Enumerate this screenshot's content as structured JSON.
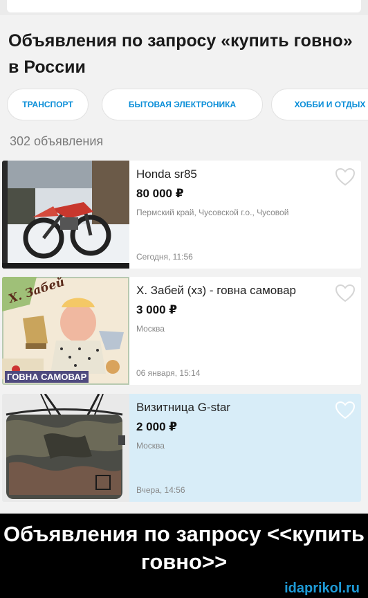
{
  "header": {
    "title": "Объявления по запросу «купить говно» в России"
  },
  "categories": [
    {
      "label": "ТРАНСПОРТ"
    },
    {
      "label": "БЫТОВАЯ ЭЛЕКТРОНИКА"
    },
    {
      "label": "ХОББИ И ОТДЫХ"
    }
  ],
  "results_count": "302 объявления",
  "listings": [
    {
      "title": "Honda sr85",
      "price": "80 000 ₽",
      "location": "Пермский край, Чусовской г.о., Чусовой",
      "date": "Сегодня, 11:56",
      "image": "motorcycle-photo",
      "highlighted": false
    },
    {
      "title": "Х. Забей (хз) - говна самовар",
      "price": "3 000 ₽",
      "location": "Москва",
      "date": "06 января, 15:14",
      "image": "painting-photo",
      "image_text": {
        "top": "Х. Забей",
        "bottom": "ГОВНА САМОВАР"
      },
      "highlighted": false
    },
    {
      "title": "Визитница G-star",
      "price": "2 000 ₽",
      "location": "Москва",
      "date": "Вчера, 14:56",
      "image": "card-holder-photo",
      "highlighted": true
    }
  ],
  "caption": {
    "text": "Объявления по запросу <<купить говно>>",
    "watermark": "idaprikol.ru"
  },
  "colors": {
    "accent": "#0a8ed8",
    "highlight_bg": "#d8edf8",
    "caption_bg": "#000000"
  }
}
